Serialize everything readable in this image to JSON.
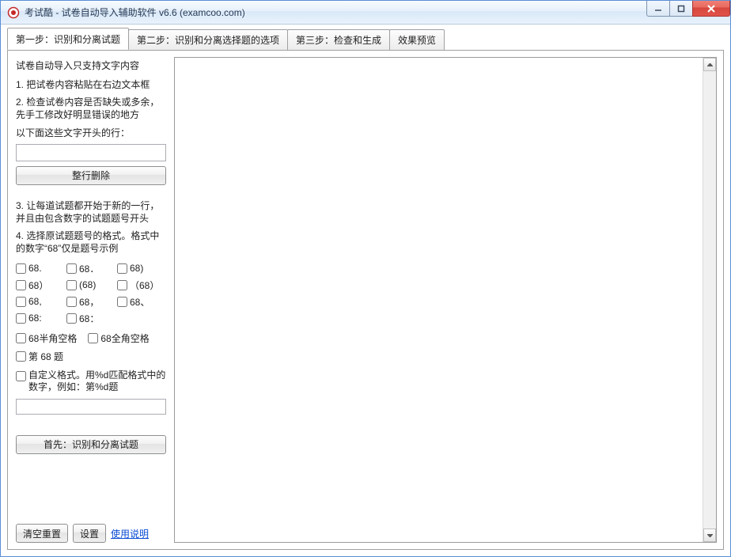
{
  "window": {
    "title": "考试酷 - 试卷自动导入辅助软件 v6.6 (examcoo.com)"
  },
  "tabs": [
    {
      "label": "第一步：识别和分离试题",
      "active": true
    },
    {
      "label": "第二步：识别和分离选择题的选项",
      "active": false
    },
    {
      "label": "第三步：检查和生成",
      "active": false
    },
    {
      "label": "效果预览",
      "active": false
    }
  ],
  "left": {
    "heading": "试卷自动导入只支持文字内容",
    "step1": "1. 把试卷内容粘贴在右边文本框",
    "step2": "2. 检查试卷内容是否缺失或多余，先手工修改好明显错误的地方",
    "prefix_label": "以下面这些文字开头的行：",
    "prefix_value": "",
    "delete_rows_btn": "整行删除",
    "step3": "3. 让每道试题都开始于新的一行，并且由包含数字的试题题号开头",
    "step4": "4. 选择原试题题号的格式。格式中的数字“68”仅是题号示例",
    "formats_row1": [
      "68.",
      "68．",
      "68)"
    ],
    "formats_row2": [
      "68）",
      "(68)",
      "（68）"
    ],
    "formats_row3": [
      "68,",
      "68，",
      "68、"
    ],
    "formats_row4": [
      "68:",
      "68："
    ],
    "formats_row5": [
      "68半角空格",
      "68全角空格"
    ],
    "formats_row6": "第 68 题",
    "custom_label": "自定义格式。用%d匹配格式中的数字，例如：第%d题",
    "custom_value": "",
    "identify_btn": "首先：识别和分离试题",
    "clear_btn": "清空重置",
    "settings_btn": "设置",
    "help_link": "使用说明"
  },
  "textarea": {
    "value": ""
  }
}
